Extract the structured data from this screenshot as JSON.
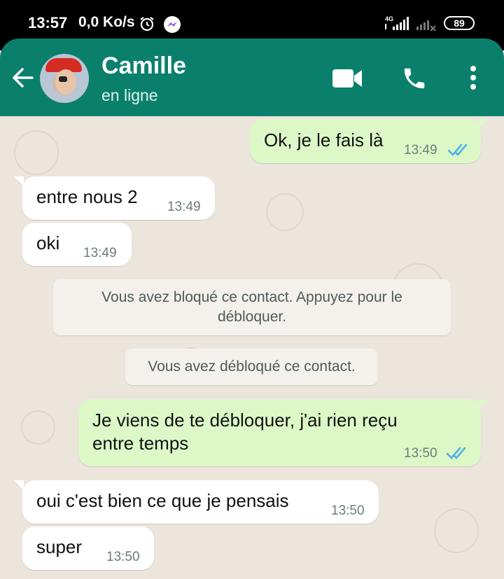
{
  "status_bar": {
    "time": "13:57",
    "speed": "0,0 Ko/s",
    "network_label": "4G",
    "battery": "89",
    "icons": [
      "alarm-icon",
      "messenger-icon",
      "signal-icon",
      "battery-icon"
    ]
  },
  "header": {
    "contact_name": "Camille",
    "contact_status": "en ligne",
    "icons": [
      "back-arrow-icon",
      "video-call-icon",
      "phone-icon",
      "more-options-icon"
    ],
    "color": "#0a806c"
  },
  "messages": [
    {
      "direction": "out",
      "text": "Ok, je le fais là",
      "time": "13:49",
      "read": true
    },
    {
      "direction": "in",
      "text": "entre nous 2",
      "time": "13:49"
    },
    {
      "direction": "in",
      "text": "oki",
      "time": "13:49"
    },
    {
      "direction": "system",
      "text": "Vous avez bloqué ce contact. Appuyez pour le débloquer."
    },
    {
      "direction": "system",
      "text": "Vous avez débloqué ce contact."
    },
    {
      "direction": "out",
      "text": "Je viens de te débloquer, j'ai rien reçu entre temps",
      "time": "13:50",
      "read": true
    },
    {
      "direction": "in",
      "text": "oui c'est bien ce que je pensais",
      "time": "13:50"
    },
    {
      "direction": "in",
      "text": "super",
      "time": "13:50"
    }
  ],
  "colors": {
    "outgoing_bubble": "#dcf8c7",
    "incoming_bubble": "#ffffff",
    "chat_background": "#ece5dc",
    "read_ticks": "#4fb0e8"
  }
}
